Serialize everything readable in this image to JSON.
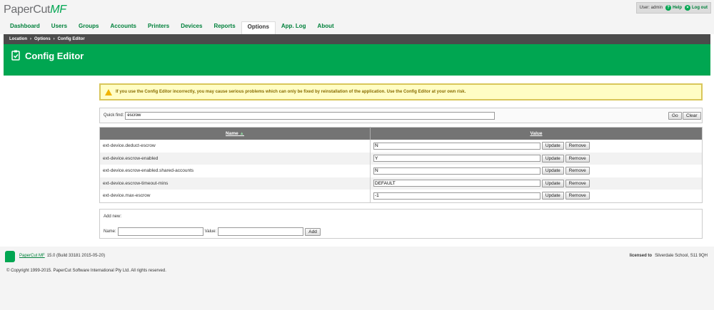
{
  "app": {
    "logo_text": "PaperCut",
    "logo_mf": "MF"
  },
  "user": {
    "label": "User: admin",
    "help": "Help",
    "logout": "Log out"
  },
  "nav": [
    "Dashboard",
    "Users",
    "Groups",
    "Accounts",
    "Printers",
    "Devices",
    "Reports",
    "Options",
    "App. Log",
    "About"
  ],
  "nav_active": "Options",
  "breadcrumb": [
    "Location",
    "Options",
    "Config Editor"
  ],
  "breadcrumb_sep": "›",
  "page_title": "Config Editor",
  "warning": "If you use the Config Editor incorrectly, you may cause serious problems which can only be fixed by reinstallation of the application. Use the Config Editor at your own risk.",
  "quickfind": {
    "label": "Quick find:",
    "value": "escrow",
    "go": "Go",
    "clear": "Clear"
  },
  "table": {
    "col_name": "Name",
    "sort_indicator": "▲",
    "col_value": "Value",
    "update_label": "Update",
    "remove_label": "Remove",
    "rows": [
      {
        "name": "ext-device.deduct-escrow",
        "value": "N"
      },
      {
        "name": "ext-device.escrow-enabled",
        "value": "Y"
      },
      {
        "name": "ext-device.escrow-enabled.shared-accounts",
        "value": "N"
      },
      {
        "name": "ext-device.escrow-timeout-mins",
        "value": "DEFAULT"
      },
      {
        "name": "ext-device.max-escrow",
        "value": "-1"
      }
    ]
  },
  "add_new": {
    "label": "Add new:",
    "name_label": "Name:",
    "value_label": "Value:",
    "add_button": "Add"
  },
  "footer": {
    "product": "PaperCut MF",
    "version": "15.0 (Build 33181 2015-05-20)",
    "licensed_label": "licensed to",
    "licensee": "Silverdale School, S11 9QH",
    "copyright": "© Copyright 1999-2015. PaperCut Software International Pty Ltd. All rights reserved."
  },
  "colors": {
    "brand_green": "#00a651",
    "nav_green": "#00813b",
    "crumb_bg": "#4b4b4b",
    "table_header": "#747474"
  }
}
